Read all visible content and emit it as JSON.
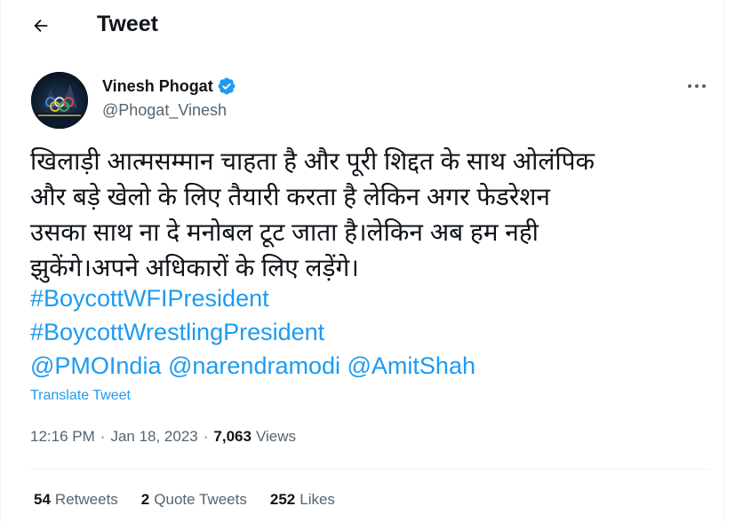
{
  "header": {
    "title": "Tweet"
  },
  "author": {
    "name": "Vinesh Phogat",
    "handle": "@Phogat_Vinesh"
  },
  "tweet": {
    "lines": [
      "खिलाड़ी आत्मसम्मान चाहता है और पूरी शिद्दत के साथ ओलंपिक",
      "और बड़े खेलो के लिए तैयारी करता है लेकिन अगर फेडरेशन",
      "उसका साथ ना दे मनोबल टूट जाता है।लेकिन अब हम नही",
      "झुकेंगे।अपने अधिकारों के लिए लड़ेंगे।"
    ],
    "hashtags": [
      "#BoycottWFIPresident",
      "#BoycottWrestlingPresident"
    ],
    "mentions": [
      "@PMOIndia",
      "@narendramodi",
      "@AmitShah"
    ],
    "translate_label": "Translate Tweet"
  },
  "meta": {
    "time": "12:16 PM",
    "date": "Jan 18, 2023",
    "separator": "·",
    "views_count": "7,063",
    "views_label": "Views"
  },
  "stats": {
    "retweets_count": "54",
    "retweets_label": "Retweets",
    "quotes_count": "2",
    "quotes_label": "Quote Tweets",
    "likes_count": "252",
    "likes_label": "Likes"
  },
  "colors": {
    "link": "#1d9bf0",
    "text": "#0f1419",
    "muted": "#536471",
    "divider": "#eff3f4"
  },
  "icons": {
    "back": "back-arrow-icon",
    "verified": "verified-badge-icon",
    "more": "more-options-icon"
  }
}
